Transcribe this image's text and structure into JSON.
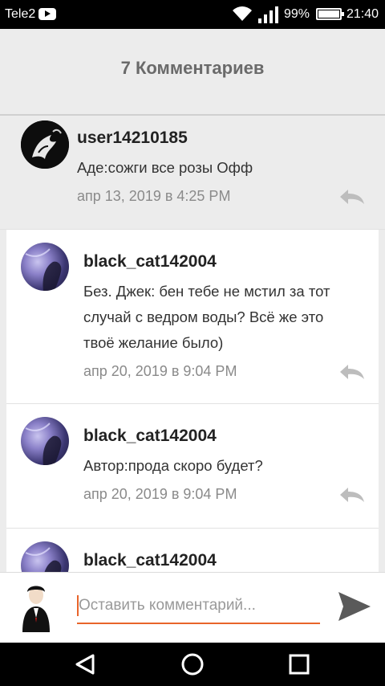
{
  "status_bar": {
    "carrier": "Tele2",
    "battery": "99%",
    "time": "21:40"
  },
  "header": {
    "title": "7 Комментариев"
  },
  "comments": [
    {
      "username": "user14210185",
      "text": "Аде:сожги все розы Офф",
      "date": "апр 13, 2019 в 4:25 PM"
    },
    {
      "username": "black_cat142004",
      "text_lines": [
        "Без. Джек: бен тебе не мстил за тот",
        "случай с ведром воды? Всё же это",
        "твоё желание было)"
      ],
      "date": "апр 20, 2019 в 9:04 PM"
    },
    {
      "username": "black_cat142004",
      "text": "Автор:прода скоро будет?",
      "date": "апр 20, 2019 в 9:04 PM"
    },
    {
      "username": "black_cat142004"
    }
  ],
  "composer": {
    "placeholder": "Оставить комментарий..."
  },
  "icons": {
    "reply": "reply-arrow-icon",
    "send": "send-icon",
    "back": "back-triangle-icon",
    "home": "home-circle-icon",
    "recents": "recents-square-icon"
  },
  "colors": {
    "accent": "#e8642a",
    "title": "#6a6a6a",
    "background": "#ececec"
  }
}
